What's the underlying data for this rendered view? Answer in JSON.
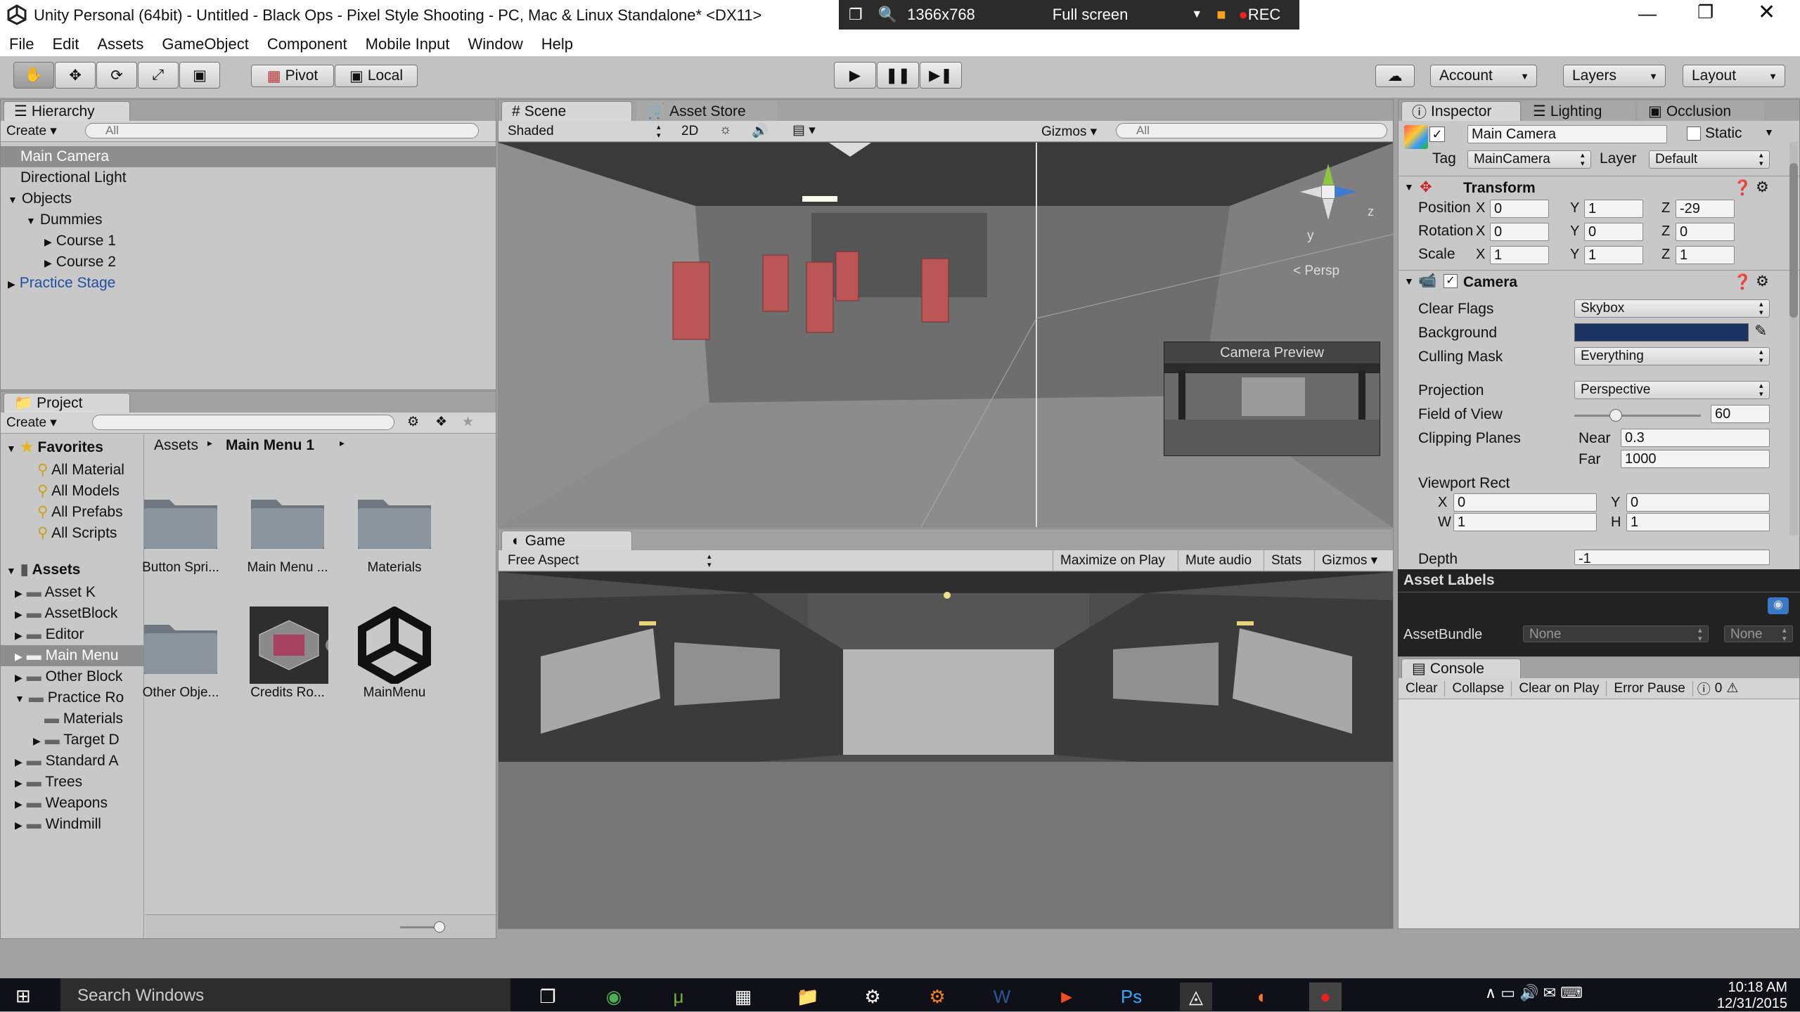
{
  "window": {
    "title": "Unity Personal (64bit) - Untitled - Black Ops - Pixel Style Shooting - PC, Mac & Linux Standalone* <DX11>"
  },
  "recorder": {
    "resolution": "1366x768",
    "mode": "Full screen",
    "rec": "REC"
  },
  "menu": [
    "File",
    "Edit",
    "Assets",
    "GameObject",
    "Component",
    "Mobile Input",
    "Window",
    "Help"
  ],
  "toolbar": {
    "pivot": "Pivot",
    "local": "Local",
    "account": "Account",
    "layers": "Layers",
    "layout": "Layout"
  },
  "hierarchy": {
    "tab": "Hierarchy",
    "create": "Create",
    "search": "All",
    "items": [
      {
        "label": "Main Camera",
        "indent": 0,
        "arrow": "",
        "selected": true
      },
      {
        "label": "Directional Light",
        "indent": 0,
        "arrow": ""
      },
      {
        "label": "Objects",
        "indent": 0,
        "arrow": "down"
      },
      {
        "label": "Dummies",
        "indent": 1,
        "arrow": "down"
      },
      {
        "label": "Course 1",
        "indent": 2,
        "arrow": "right"
      },
      {
        "label": "Course 2",
        "indent": 2,
        "arrow": "right"
      },
      {
        "label": "Practice Stage",
        "indent": 0,
        "arrow": "right",
        "prefab": true
      }
    ]
  },
  "project": {
    "tab": "Project",
    "create": "Create",
    "breadcrumb": [
      "Assets",
      "Main Menu 1"
    ],
    "favorites_label": "Favorites",
    "favorites": [
      "All Material",
      "All Models",
      "All Prefabs",
      "All Scripts"
    ],
    "assets_label": "Assets",
    "tree": [
      {
        "label": "Asset K",
        "arrow": "right"
      },
      {
        "label": "AssetBlock",
        "arrow": "right"
      },
      {
        "label": "Editor",
        "arrow": "right"
      },
      {
        "label": "Main Menu",
        "arrow": "right",
        "selected": true
      },
      {
        "label": "Other Block",
        "arrow": "right"
      },
      {
        "label": "Practice Ro",
        "arrow": "down"
      },
      {
        "label": "Materials",
        "arrow": "",
        "indent": 1
      },
      {
        "label": "Target D",
        "arrow": "right",
        "indent": 1
      },
      {
        "label": "Standard A",
        "arrow": "right"
      },
      {
        "label": "Trees",
        "arrow": "right"
      },
      {
        "label": "Weapons",
        "arrow": "right"
      },
      {
        "label": "Windmill",
        "arrow": "right"
      }
    ],
    "files": [
      {
        "name": "Button Spri...",
        "kind": "folder"
      },
      {
        "name": "Main Menu ...",
        "kind": "folder"
      },
      {
        "name": "Materials",
        "kind": "folder"
      },
      {
        "name": "Other Obje...",
        "kind": "folder"
      },
      {
        "name": "Credits Ro...",
        "kind": "prefab"
      },
      {
        "name": "MainMenu",
        "kind": "unity"
      }
    ]
  },
  "scene": {
    "tab": "Scene",
    "tab2": "Asset Store",
    "shading": "Shaded",
    "mode2d": "2D",
    "gizmos": "Gizmos",
    "search": "All",
    "persp": "Persp",
    "preview": "Camera Preview"
  },
  "game": {
    "tab": "Game",
    "aspect": "Free Aspect",
    "buttons": [
      "Maximize on Play",
      "Mute audio",
      "Stats",
      "Gizmos"
    ]
  },
  "inspector": {
    "tabs": [
      "Inspector",
      "Lighting",
      "Occlusion"
    ],
    "name": "Main Camera",
    "static": "Static",
    "tag_label": "Tag",
    "tag": "MainCamera",
    "layer_label": "Layer",
    "layer": "Default",
    "transform": {
      "title": "Transform",
      "rows": [
        {
          "label": "Position",
          "x": "0",
          "y": "1",
          "z": "-29"
        },
        {
          "label": "Rotation",
          "x": "0",
          "y": "0",
          "z": "0"
        },
        {
          "label": "Scale",
          "x": "1",
          "y": "1",
          "z": "1"
        }
      ]
    },
    "camera": {
      "title": "Camera",
      "clear_flags_label": "Clear Flags",
      "clear_flags": "Skybox",
      "background_label": "Background",
      "background_color": "#1c3260",
      "culling_label": "Culling Mask",
      "culling": "Everything",
      "projection_label": "Projection",
      "projection": "Perspective",
      "fov_label": "Field of View",
      "fov": "60",
      "fov_fraction": 0.33,
      "clip_label": "Clipping Planes",
      "near_label": "Near",
      "near": "0.3",
      "far_label": "Far",
      "far": "1000",
      "viewport_label": "Viewport Rect",
      "vx": "0",
      "vy": "0",
      "vw": "1",
      "vh": "1",
      "depth_label": "Depth",
      "depth": "-1"
    },
    "asset_labels": "Asset Labels",
    "assetbundle_label": "AssetBundle",
    "assetbundle": "None",
    "assetbundle2": "None"
  },
  "console": {
    "tab": "Console",
    "buttons": [
      "Clear",
      "Collapse",
      "Clear on Play",
      "Error Pause"
    ],
    "count": "0"
  },
  "taskbar": {
    "search": "Search Windows",
    "time": "10:18 AM",
    "date": "12/31/2015"
  }
}
